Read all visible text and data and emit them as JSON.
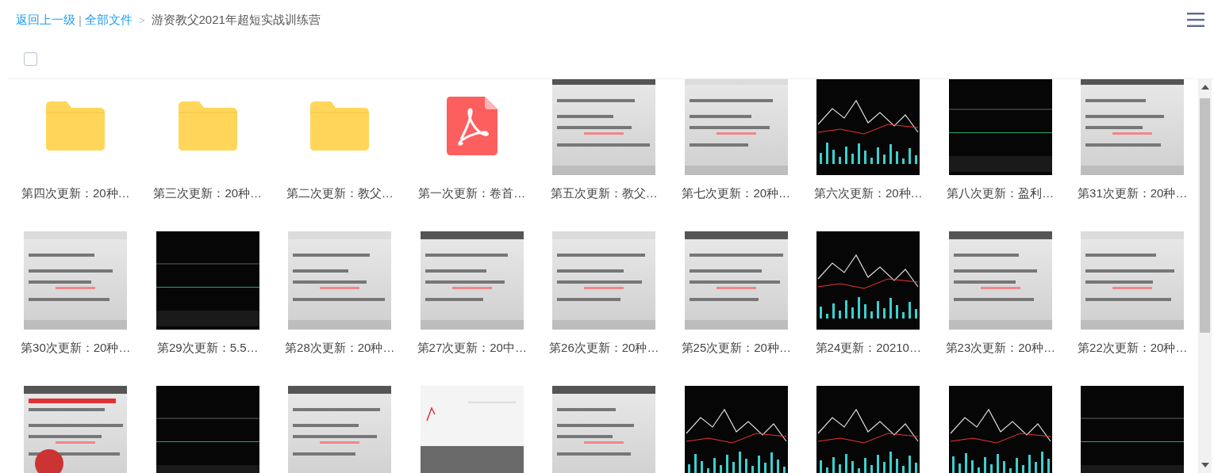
{
  "breadcrumb": [
    {
      "kind": "link",
      "label": "返回上一级"
    },
    {
      "kind": "divider",
      "label": "|"
    },
    {
      "kind": "link",
      "label": "全部文件"
    },
    {
      "kind": "arrow",
      "label": ">"
    },
    {
      "kind": "current",
      "label": "游资教父2021年超短实战训练营"
    }
  ],
  "select_all": {
    "checked": false
  },
  "files": [
    {
      "kind": "folder",
      "label": "第四次更新：20种…"
    },
    {
      "kind": "folder",
      "label": "第三次更新：20种…"
    },
    {
      "kind": "folder",
      "label": "第二次更新：教父…"
    },
    {
      "kind": "pdf",
      "label": "第一次更新：卷首…"
    },
    {
      "kind": "picture",
      "label": "第五次更新：教父…"
    },
    {
      "kind": "picture",
      "label": "第七次更新：20种…"
    },
    {
      "kind": "picture",
      "label": "第六次更新：20种…"
    },
    {
      "kind": "picture",
      "label": "第八次更新：盈利…"
    },
    {
      "kind": "picture",
      "label": "第31次更新：20种…"
    },
    {
      "kind": "picture",
      "label": "第30次更新：20种…"
    },
    {
      "kind": "picture",
      "label": "第29次更新：5.5…"
    },
    {
      "kind": "picture",
      "label": "第28次更新：20种…"
    },
    {
      "kind": "picture",
      "label": "第27次更新：20中…"
    },
    {
      "kind": "picture",
      "label": "第26次更新：20种…"
    },
    {
      "kind": "picture",
      "label": "第25次更新：20种…"
    },
    {
      "kind": "picture",
      "label": "第24更新：20210…"
    },
    {
      "kind": "picture",
      "label": "第23次更新：20种…"
    },
    {
      "kind": "picture",
      "label": "第22次更新：20种…"
    },
    {
      "kind": "picture"
    },
    {
      "kind": "picture"
    },
    {
      "kind": "picture"
    },
    {
      "kind": "picture"
    },
    {
      "kind": "picture"
    },
    {
      "kind": "picture"
    },
    {
      "kind": "picture"
    },
    {
      "kind": "picture"
    },
    {
      "kind": "picture"
    }
  ]
}
